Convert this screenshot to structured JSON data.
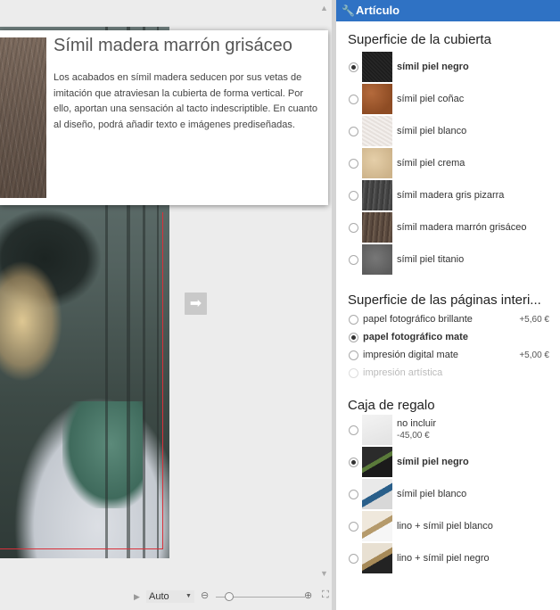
{
  "tooltip": {
    "title": "Símil madera marrón grisáceo",
    "body": "Los acabados en símil madera seducen por sus vetas de imitación que atraviesan la cubierta de forma vertical. Por ello, aportan una sensación al tacto indescriptible. En cuanto al diseño, podrá añadir texto e imágenes prediseñadas."
  },
  "zoom": {
    "value": "Auto"
  },
  "panel": {
    "header": "Artículo",
    "cover": {
      "title": "Superficie de la cubierta",
      "options": [
        {
          "label": "símil piel negro",
          "selected": true
        },
        {
          "label": "símil piel coñac",
          "selected": false
        },
        {
          "label": "símil piel blanco",
          "selected": false
        },
        {
          "label": "símil piel crema",
          "selected": false
        },
        {
          "label": "símil madera gris pizarra",
          "selected": false
        },
        {
          "label": "símil madera marrón grisáceo",
          "selected": false
        },
        {
          "label": "símil piel titanio",
          "selected": false
        }
      ]
    },
    "pages": {
      "title": "Superficie de las páginas interi...",
      "options": [
        {
          "label": "papel fotográfico brillante",
          "price": "+5,60 €",
          "selected": false,
          "disabled": false
        },
        {
          "label": "papel fotográfico mate",
          "price": "",
          "selected": true,
          "disabled": false
        },
        {
          "label": "impresión digital mate",
          "price": "+5,00 €",
          "selected": false,
          "disabled": false
        },
        {
          "label": "impresión artística",
          "price": "",
          "selected": false,
          "disabled": true
        }
      ]
    },
    "giftbox": {
      "title": "Caja de regalo",
      "options": [
        {
          "label": "no incluir",
          "sublabel": "-45,00 €",
          "selected": false
        },
        {
          "label": "símil piel negro",
          "selected": true
        },
        {
          "label": "símil piel blanco",
          "selected": false
        },
        {
          "label": "lino + símil piel blanco",
          "selected": false
        },
        {
          "label": "lino + símil piel negro",
          "selected": false
        }
      ]
    }
  }
}
